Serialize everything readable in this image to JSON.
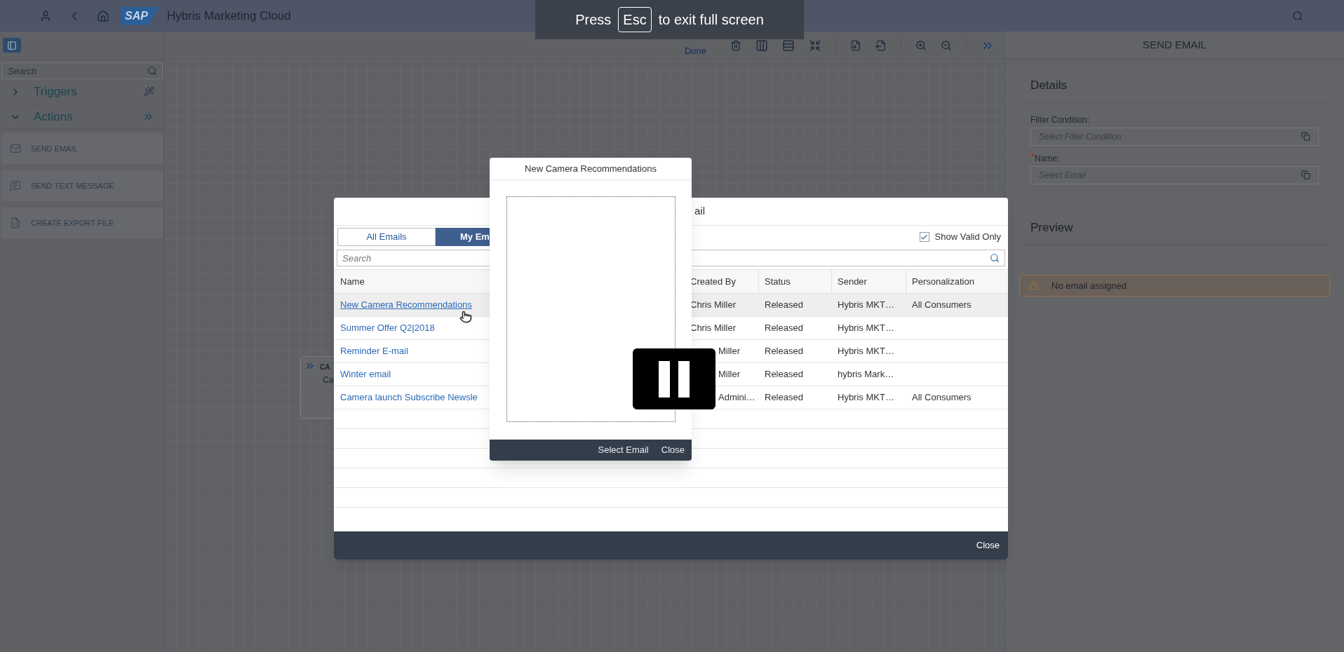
{
  "fullscreen_hint": {
    "before": "Press",
    "key": "Esc",
    "after": "to exit full screen"
  },
  "shell": {
    "logo": "SAP",
    "title": "Hybris Marketing Cloud"
  },
  "toolbar": {
    "done": "Done"
  },
  "sidebar": {
    "search": {
      "placeholder": "Search"
    },
    "groups": [
      {
        "label": "Triggers",
        "kind": "triggers",
        "expanded": false
      },
      {
        "label": "Actions",
        "kind": "actions",
        "expanded": true
      }
    ],
    "actions": [
      {
        "label": "SEND EMAIL",
        "kind": "email"
      },
      {
        "label": "SEND TEXT MESSAGE",
        "kind": "message"
      },
      {
        "label": "CREATE EXPORT FILE",
        "kind": "export"
      }
    ]
  },
  "canvas": {
    "node": {
      "title": "CA",
      "subtitle": "Ca"
    }
  },
  "dialog": {
    "title": "ail",
    "tabs": [
      {
        "label": "All Emails",
        "selected": false
      },
      {
        "label": "My Em",
        "selected": true
      }
    ],
    "show_valid_only": {
      "label": "Show Valid Only",
      "checked": true
    },
    "search": {
      "placeholder": "Search"
    },
    "columns": [
      "Name",
      "Created By",
      "Status",
      "Sender",
      "Personalization"
    ],
    "rows": [
      {
        "name": "New Camera Recommendations",
        "created_by": "Chris Miller",
        "status": "Released",
        "sender": "Hybris MKT…",
        "personalization": "All Consumers",
        "selected": true
      },
      {
        "name": "Summer Offer Q2|2018",
        "created_by": "Chris Miller",
        "status": "Released",
        "sender": "Hybris MKT…",
        "selected": false
      },
      {
        "name": "Reminder E-mail",
        "created_by": "Miller",
        "status": "Released",
        "sender": "Hybris MKT…",
        "selected": false
      },
      {
        "name": "Winter email",
        "created_by": "Miller",
        "status": "Released",
        "sender": "hybris Mark…",
        "selected": false
      },
      {
        "name": "Camera launch Subscribe Newsle",
        "created_by": "Admini…",
        "status": "Released",
        "sender": "Hybris MKT…",
        "personalization": "All Consumers",
        "selected": false
      }
    ],
    "footer_button": "Close"
  },
  "popover": {
    "title": "New Camera Recommendations",
    "buttons": [
      "Select Email",
      "Close"
    ]
  },
  "panel": {
    "title": "SEND EMAIL",
    "details": "Details",
    "fields": [
      {
        "label": "Filter Condition:",
        "required": false,
        "placeholder": "Select Filter Condition"
      },
      {
        "label": "Name:",
        "required": true,
        "placeholder": "Select Email"
      }
    ],
    "preview": "Preview",
    "warning": "No email assigned"
  }
}
